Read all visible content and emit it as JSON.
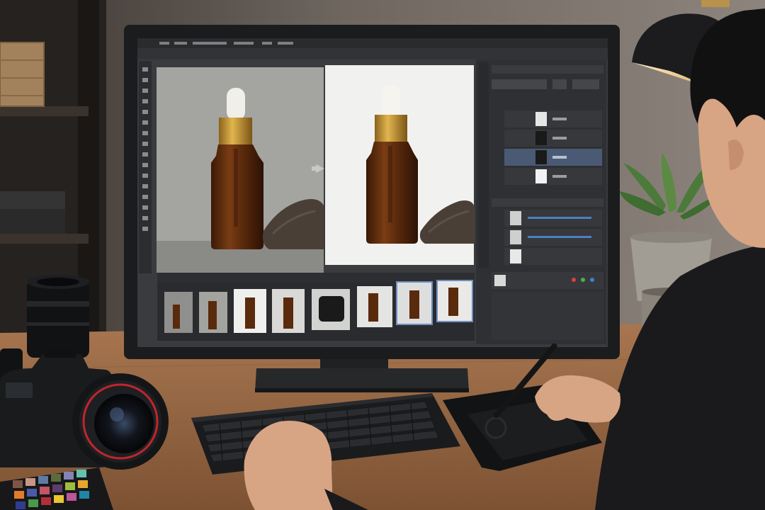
{
  "scene": {
    "description_type": "photo",
    "colors": {
      "wall": "#7c746d",
      "desk": "#9a6a45",
      "monitor_bezel": "#1b1c1e",
      "editor_bg": "#3a3b3e",
      "panel_bg": "#2f3033",
      "bottle_glass": "#6b3412",
      "bottle_cap": "#c8962f",
      "dropper": "#f1efe9",
      "shirt": "#1a1a1c",
      "skin": "#d8a584",
      "lamp": "#1c1c1e",
      "plant": "#4c7a3a",
      "mug": "#8b847b"
    },
    "filmstrip_count": 8,
    "layer_count": 4,
    "adjustment_count": 3
  }
}
